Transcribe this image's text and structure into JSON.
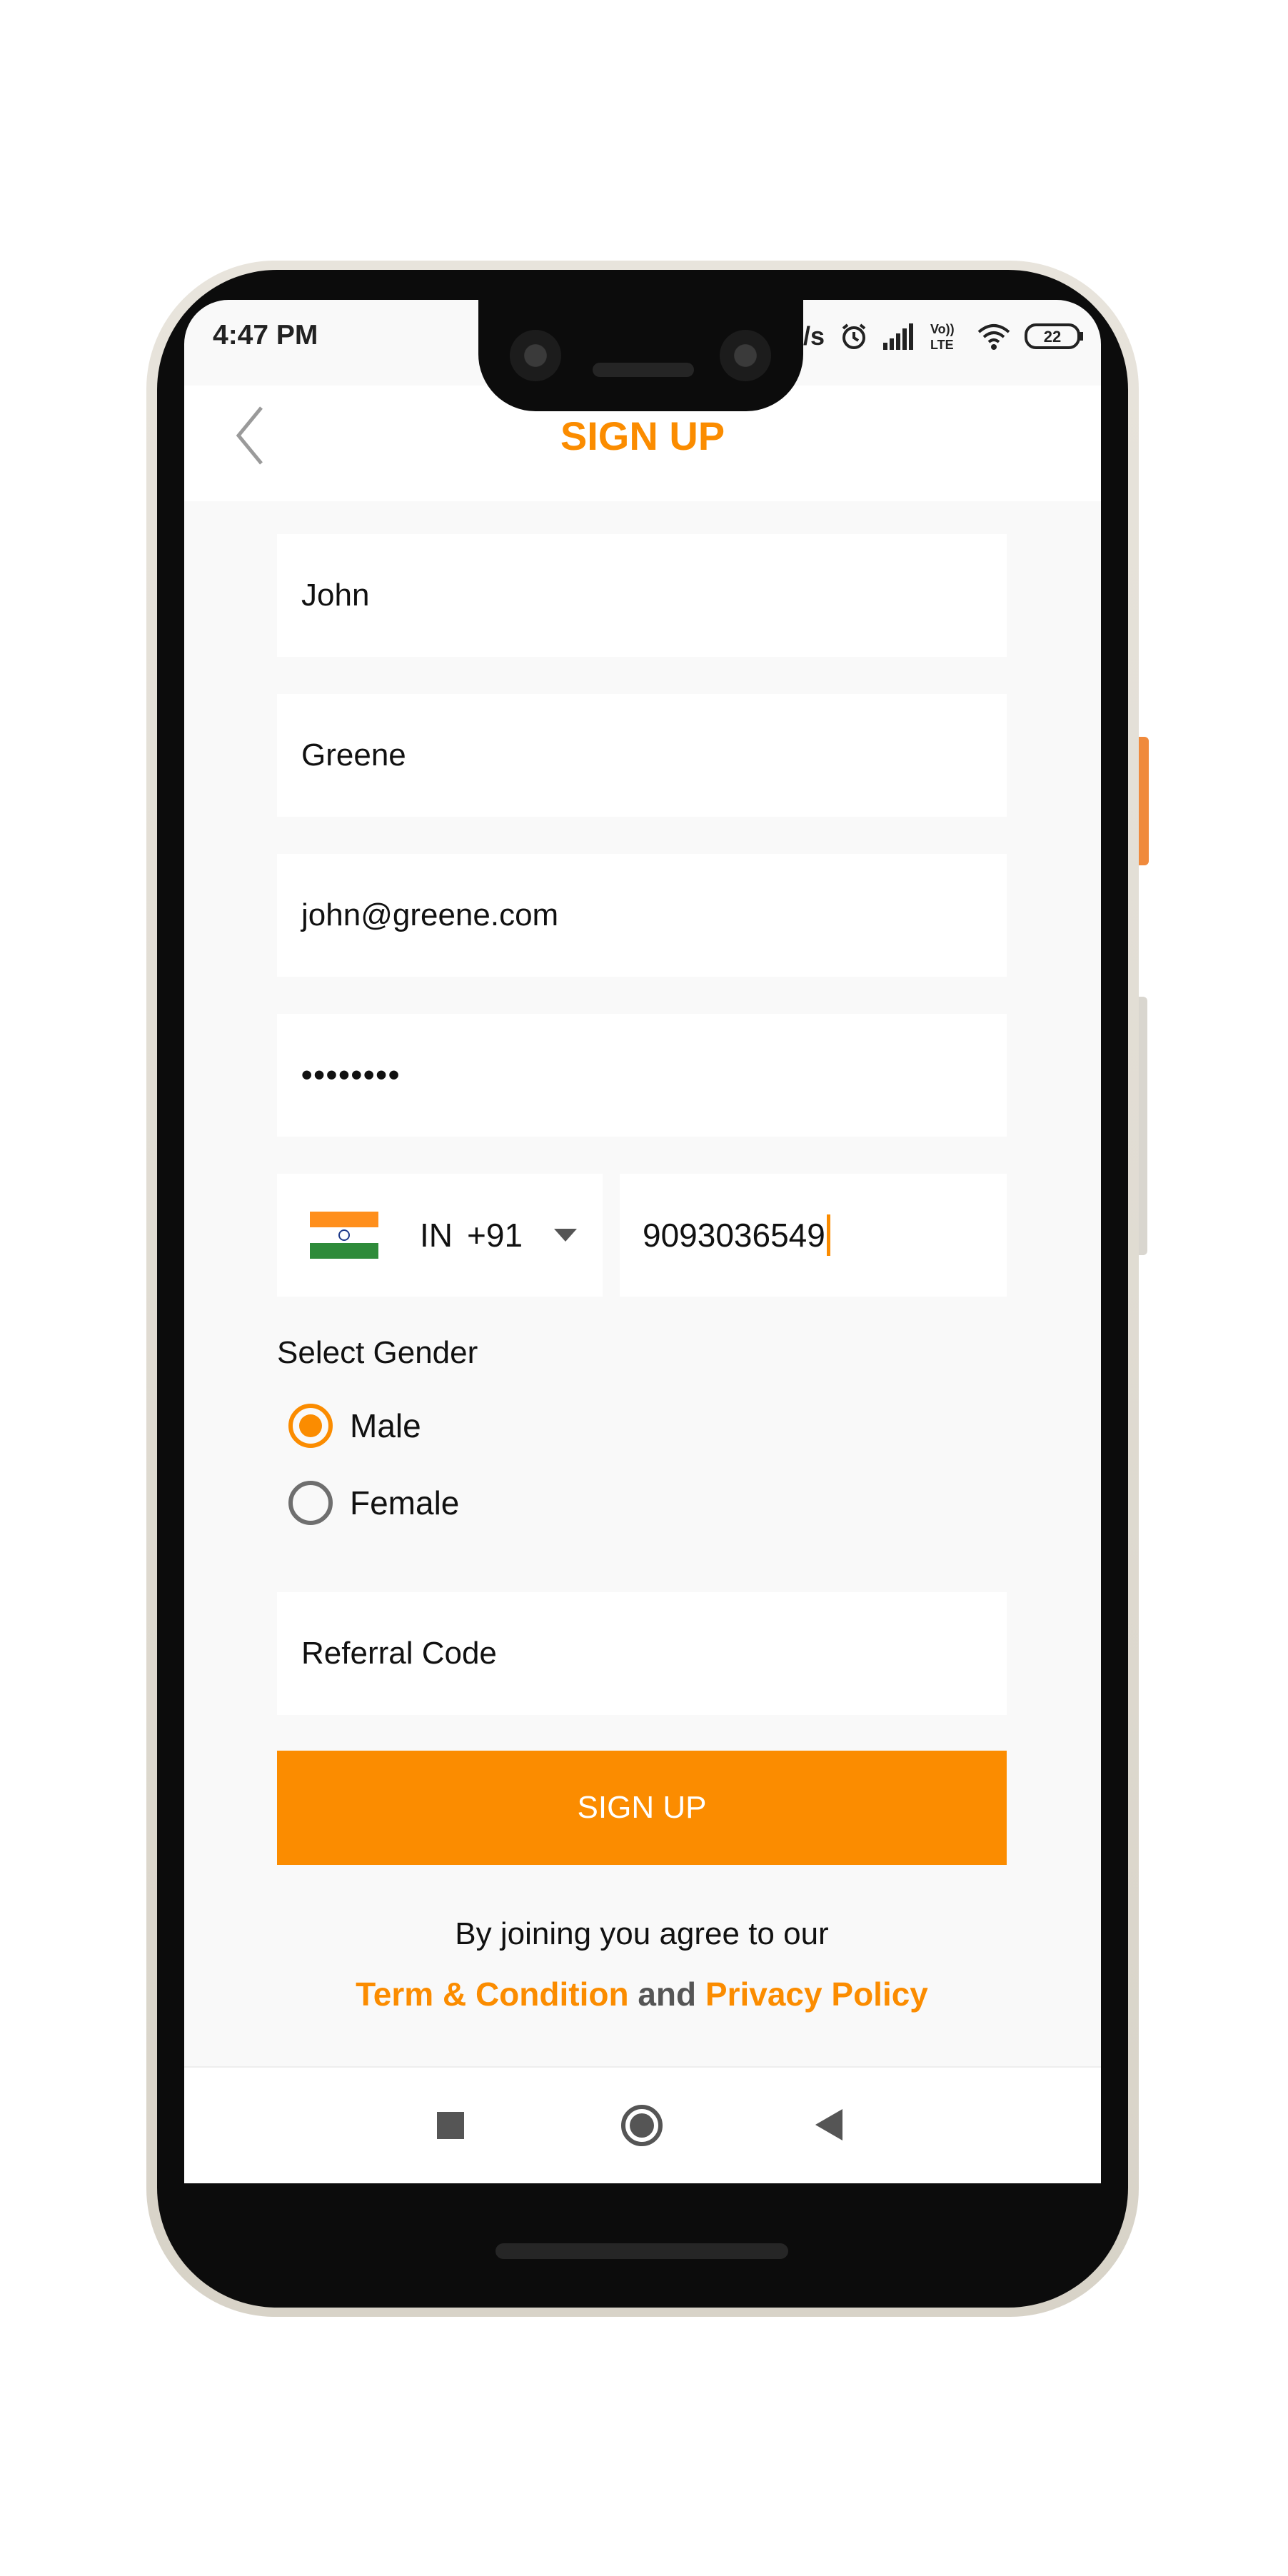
{
  "status_bar": {
    "time": "4:47 PM",
    "speed_fragment": "/s",
    "battery": "22",
    "icons": [
      "alarm-icon",
      "signal-icon",
      "volte-icon",
      "wifi-icon",
      "battery-icon"
    ]
  },
  "header": {
    "title": "SIGN UP",
    "back_icon": "chevron-left-icon"
  },
  "form": {
    "first_name": "John",
    "last_name": "Greene",
    "email": "john@greene.com",
    "password": "••••••••",
    "country_code": "IN",
    "dial_code": "+91",
    "phone": "9093036549",
    "gender_label": "Select Gender",
    "gender_options": [
      "Male",
      "Female"
    ],
    "gender_selected": "Male",
    "referral_placeholder": "Referral Code",
    "submit_label": "SIGN UP"
  },
  "footer": {
    "agree_text": "By joining you agree to our",
    "terms_label": "Term & Condition",
    "and_text": "and",
    "privacy_label": "Privacy Policy"
  },
  "colors": {
    "accent": "#fb8c00",
    "background": "#f9f9f9"
  }
}
